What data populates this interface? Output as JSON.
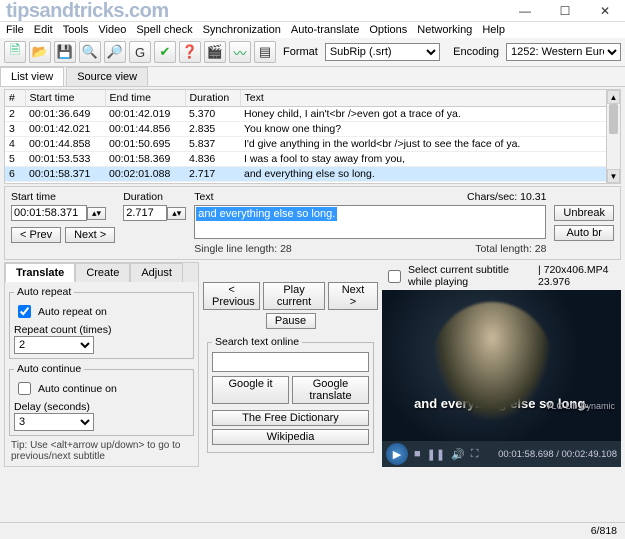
{
  "watermark": "tipsandtricks.com",
  "window_controls": {
    "min": "—",
    "max": "☐",
    "close": "✕"
  },
  "menu": [
    "File",
    "Edit",
    "Tools",
    "Video",
    "Spell check",
    "Synchronization",
    "Auto-translate",
    "Options",
    "Networking",
    "Help"
  ],
  "toolbar_icons": [
    {
      "name": "new-file-icon",
      "glyph": "🗎",
      "color": "#2b7"
    },
    {
      "name": "open-file-icon",
      "glyph": "📂",
      "color": "#d90"
    },
    {
      "name": "save-icon",
      "glyph": "💾",
      "color": "#36c"
    },
    {
      "name": "find-icon",
      "glyph": "🔍",
      "color": "#333"
    },
    {
      "name": "replace-icon",
      "glyph": "🔎",
      "color": "#333"
    },
    {
      "name": "sync-icon",
      "glyph": "G",
      "color": "#333"
    },
    {
      "name": "spellcheck-icon",
      "glyph": "✔",
      "color": "#2a2"
    },
    {
      "name": "help-icon",
      "glyph": "❓",
      "color": "#36c"
    },
    {
      "name": "visualsync-icon",
      "glyph": "🎬",
      "color": "#333"
    },
    {
      "name": "waveform-icon",
      "glyph": "〰",
      "color": "#093"
    },
    {
      "name": "spectrogram-icon",
      "glyph": "▤",
      "color": "#333"
    }
  ],
  "format_label": "Format",
  "format_value": "SubRip (.srt)",
  "encoding_label": "Encoding",
  "encoding_value": "1252: Western Euro",
  "main_tabs": {
    "list_view": "List view",
    "source_view": "Source view"
  },
  "columns": [
    "#",
    "Start time",
    "End time",
    "Duration",
    "Text"
  ],
  "rows": [
    {
      "n": "2",
      "st": "00:01:36.649",
      "et": "00:01:42.019",
      "dur": "5.370",
      "txt": "Honey child, I ain't<br />even got a trace of ya."
    },
    {
      "n": "3",
      "st": "00:01:42.021",
      "et": "00:01:44.856",
      "dur": "2.835",
      "txt": "You know one thing?"
    },
    {
      "n": "4",
      "st": "00:01:44.858",
      "et": "00:01:50.695",
      "dur": "5.837",
      "txt": "I'd give anything in the world<br />just to see the face of ya."
    },
    {
      "n": "5",
      "st": "00:01:53.533",
      "et": "00:01:58.369",
      "dur": "4.836",
      "txt": "I was a fool to stay away from you,"
    },
    {
      "n": "6",
      "st": "00:01:58.371",
      "et": "00:02:01.088",
      "dur": "2.717",
      "txt": "and everything else so long."
    }
  ],
  "edit": {
    "start_label": "Start time",
    "start_value": "00:01:58.371",
    "dur_label": "Duration",
    "dur_value": "2.717",
    "text_label": "Text",
    "text_value": "and everything else so long.",
    "chars_label": "Chars/sec:",
    "chars_value": "10.31",
    "single_line": "Single line length: 28",
    "total_len": "Total length: 28",
    "unbreak": "Unbreak",
    "autobr": "Auto br",
    "prev": "< Prev",
    "next": "Next >"
  },
  "bottom_tabs": {
    "translate": "Translate",
    "create": "Create",
    "adjust": "Adjust"
  },
  "auto_repeat": {
    "legend": "Auto repeat",
    "check_label": "Auto repeat on",
    "checked": true,
    "count_label": "Repeat count (times)",
    "count_value": "2"
  },
  "auto_continue": {
    "legend": "Auto continue",
    "check_label": "Auto continue on",
    "checked": false,
    "delay_label": "Delay (seconds)",
    "delay_value": "3"
  },
  "tip": "Tip: Use <alt+arrow up/down> to go to previous/next subtitle",
  "play": {
    "prev": "< Previous",
    "play": "Play current",
    "next": "Next >",
    "pause": "Pause"
  },
  "search": {
    "legend": "Search text online",
    "google": "Google it",
    "gtrans": "Google translate",
    "dict": "The Free Dictionary",
    "wiki": "Wikipedia"
  },
  "video": {
    "checkbox_label": "Select current subtitle while playing",
    "info": "| 720x406.MP4 23.976",
    "subtitle": "and everything else so long.",
    "vlc": "VLC Lib Dynamic",
    "time": "00:01:58.698 / 00:02:49.108"
  },
  "status": "6/818"
}
